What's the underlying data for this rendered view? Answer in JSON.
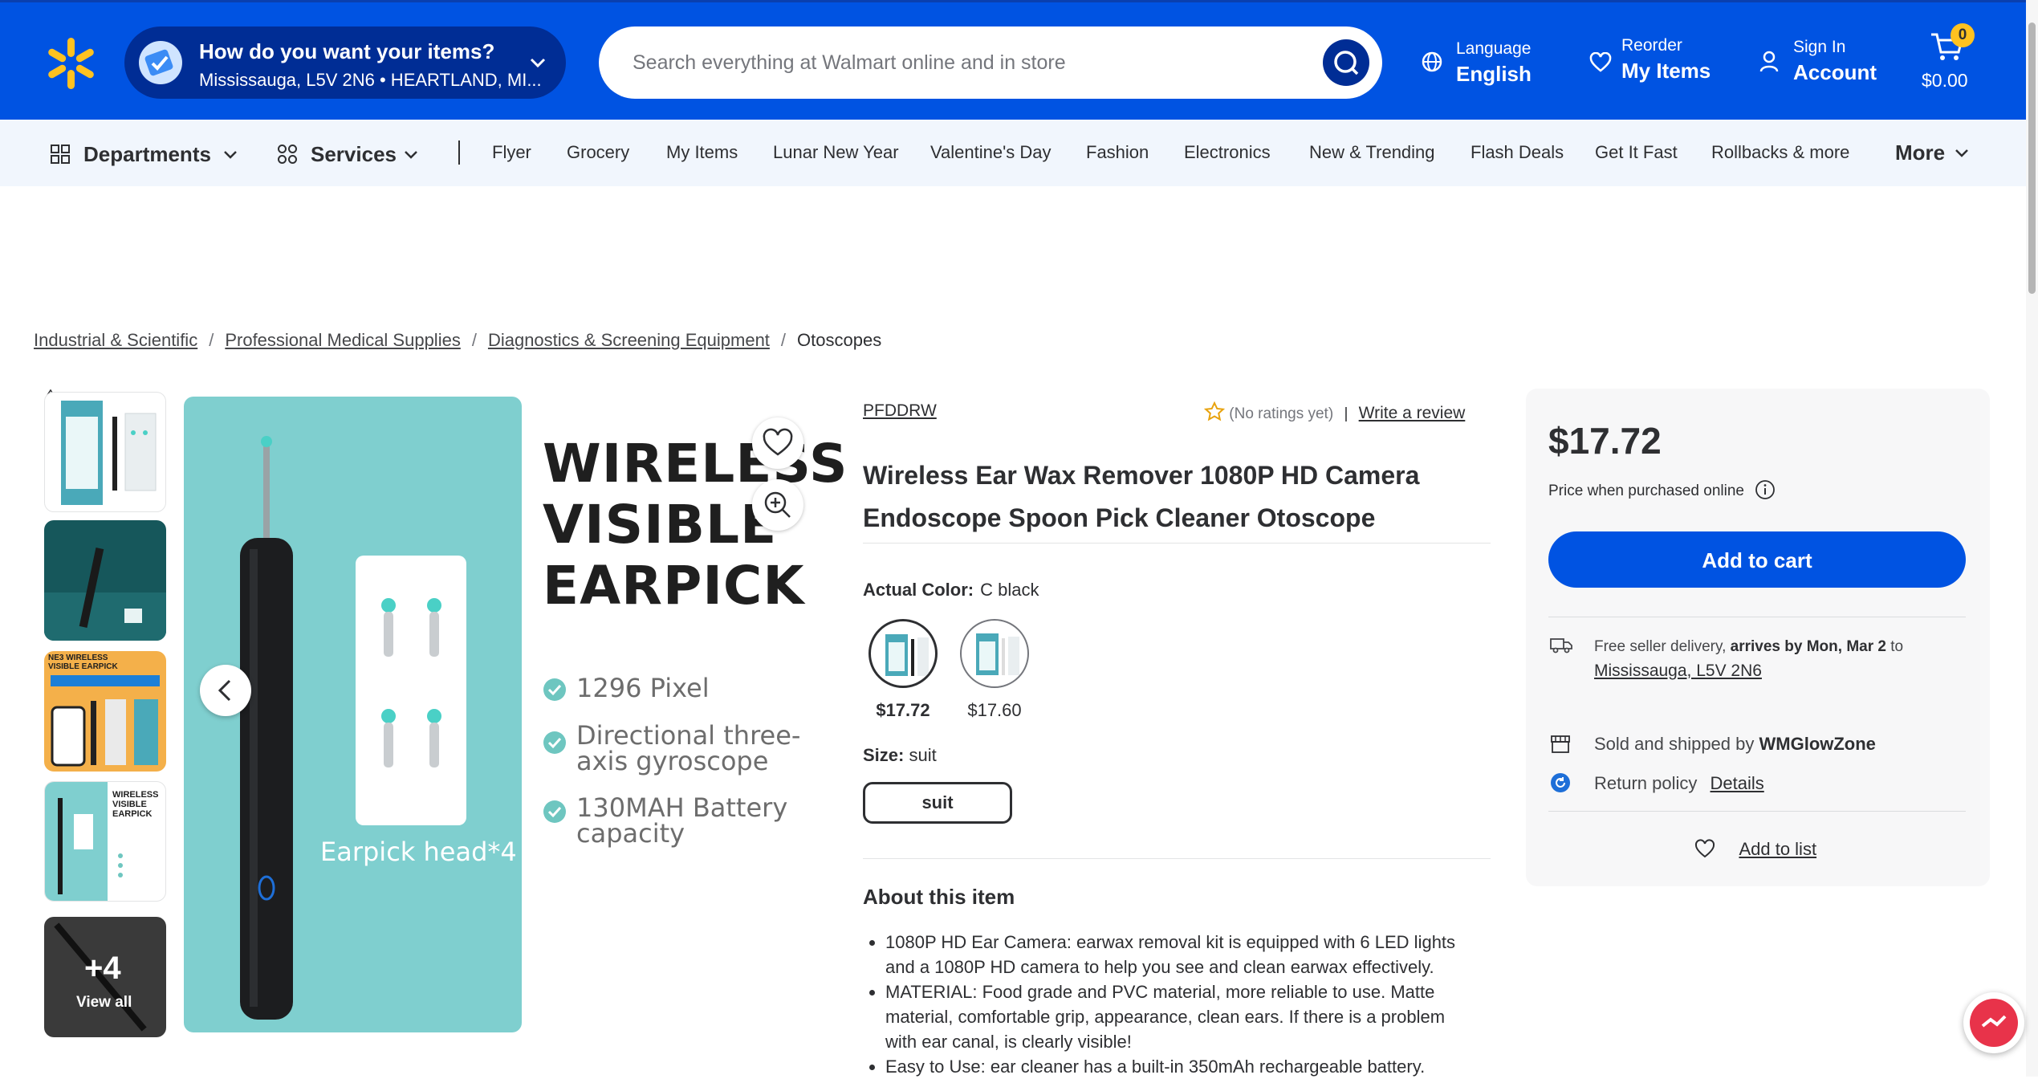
{
  "header": {
    "fulfillment_title": "How do you want your items?",
    "fulfillment_location": "Mississauga, L5V 2N6 • HEARTLAND, MI...",
    "search_placeholder": "Search everything at Walmart online and in store",
    "language_label": "Language",
    "language_value": "English",
    "reorder_label": "Reorder",
    "reorder_value": "My Items",
    "signin_label": "Sign In",
    "signin_value": "Account",
    "cart_count": "0",
    "cart_total": "$0.00",
    "brand_color": "#0053e2"
  },
  "nav": {
    "departments": "Departments",
    "services": "Services",
    "items": [
      "Flyer",
      "Grocery",
      "My Items",
      "Lunar New Year",
      "Valentine's Day",
      "Fashion",
      "Electronics",
      "New & Trending",
      "Flash Deals",
      "Get It Fast",
      "Rollbacks & more"
    ],
    "more": "More"
  },
  "breadcrumb": [
    "Industrial & Scientific",
    "Professional Medical Supplies",
    "Diagnostics & Screening Equipment",
    "Otoscopes"
  ],
  "gallery": {
    "view_all_count": "+4",
    "view_all_label": "View all",
    "thumb3_text": "NE3 WIRELESS VISIBLE EARPICK",
    "thumb4_text": "WIRELESS VISIBLE EARPICK",
    "image_heading": "WIRELESS VISIBLE EARPICK",
    "image_features": [
      "1296 Pixel",
      "Directional three-axis gyroscope",
      "130MAH Battery capacity"
    ],
    "image_caption": "Earpick head*4"
  },
  "product": {
    "brand": "PFDDRW",
    "ratings_text": "(No ratings yet)",
    "write_review": "Write a review",
    "title": "Wireless Ear Wax Remover 1080P HD Camera Endoscope Spoon Pick Cleaner Otoscope",
    "color_label": "Actual Color:",
    "color_value": "C black",
    "variants": [
      {
        "price": "$17.72",
        "selected": true
      },
      {
        "price": "$17.60",
        "selected": false
      }
    ],
    "size_label": "Size:",
    "size_value": "suit",
    "size_option": "suit",
    "about_heading": "About this item",
    "bullets": [
      "1080P HD Ear Camera: earwax removal kit is equipped with 6 LED lights and a 1080P HD camera to help you see and clean earwax effectively.",
      "MATERIAL: Food grade and PVC material, more reliable to use. Matte material, comfortable grip, appearance, clean ears. If there is a problem with ear canal, is clearly visible!",
      "Easy to Use: ear cleaner has a built-in 350mAh rechargeable battery."
    ]
  },
  "buybox": {
    "price": "$17.72",
    "price_note": "Price when purchased online",
    "add_to_cart": "Add to cart",
    "delivery_prefix": "Free seller delivery,",
    "delivery_bold": "arrives by Mon, Mar 2",
    "delivery_suffix": "to",
    "delivery_location": "Mississauga, L5V 2N6",
    "sold_prefix": "Sold and shipped by",
    "seller": "WMGlowZone",
    "return_label": "Return policy",
    "return_link": "Details",
    "add_to_list": "Add to list"
  }
}
